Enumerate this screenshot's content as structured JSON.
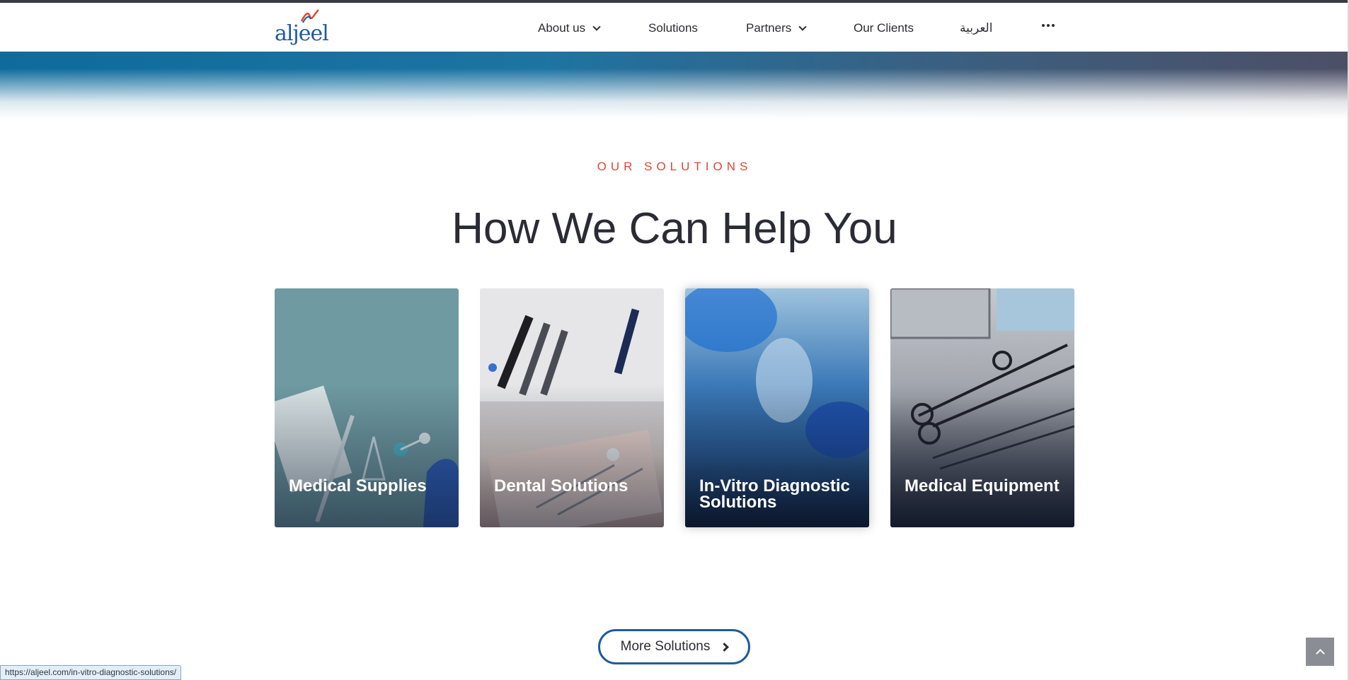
{
  "header": {
    "logo_text": "aljeel",
    "nav": [
      {
        "label": "About us",
        "has_dropdown": true
      },
      {
        "label": "Solutions",
        "has_dropdown": false
      },
      {
        "label": "Partners",
        "has_dropdown": true
      },
      {
        "label": "Our Clients",
        "has_dropdown": false
      },
      {
        "label": "العربية",
        "has_dropdown": false
      }
    ],
    "more_icon": "more-horizontal-icon"
  },
  "section": {
    "eyebrow": "OUR SOLUTIONS",
    "title": "How We Can Help You"
  },
  "cards": [
    {
      "title": "Medical Supplies"
    },
    {
      "title": "Dental Solutions"
    },
    {
      "title": "In-Vitro Diagnostic Solutions"
    },
    {
      "title": "Medical Equipment"
    }
  ],
  "cta": {
    "label": "More Solutions",
    "icon": "chevron-right-icon"
  },
  "scroll_top_icon": "chevron-up-icon",
  "status_bar": {
    "url": "https://aljeel.com/in-vitro-diagnostic-solutions/"
  },
  "colors": {
    "accent": "#e24530",
    "brand": "#1f5c9a",
    "text": "#2b2b35"
  }
}
